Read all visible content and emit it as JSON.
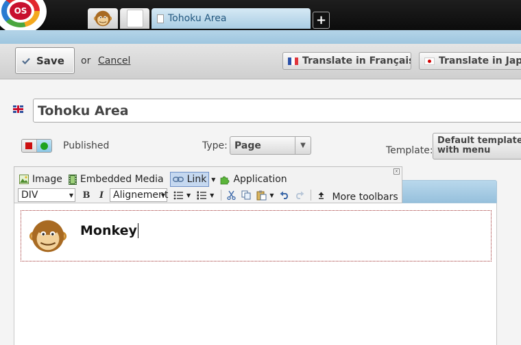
{
  "tabs": {
    "logo_text": "OS",
    "active_label": "Tohoku Area",
    "add_label": "+"
  },
  "actions": {
    "save_label": "Save",
    "or_text": "or",
    "cancel_label": "Cancel",
    "translate_fr": "Translate in Français",
    "translate_jp": "Translate in Japanese"
  },
  "form": {
    "title_value": "Tohoku Area",
    "status_label": "Published",
    "type_label": "Type:",
    "type_value": "Page",
    "template_label": "Template:",
    "template_value": "Default template with menu"
  },
  "editor": {
    "insert_image": "Image",
    "insert_media": "Embedded Media",
    "insert_link": "Link",
    "insert_app": "Application",
    "format_value": "DIV",
    "align_value": "Alignement",
    "bold": "B",
    "italic": "I",
    "more_toolbars": "More toolbars",
    "close_symbol": "x",
    "content_text": "Monkey"
  },
  "colors": {
    "tab_blue": "#a9cde3",
    "status_off": "#cc1010",
    "status_on": "#1fa31f",
    "link_text": "#23587f"
  },
  "icons": [
    "os-logo-icon",
    "monkey-icon",
    "page-icon",
    "check-icon",
    "flag-fr-icon",
    "flag-jp-icon",
    "flag-uk-icon",
    "image-icon",
    "film-icon",
    "link-icon",
    "puzzle-icon",
    "bullet-list-icon",
    "number-list-icon",
    "cut-icon",
    "copy-icon",
    "paste-icon",
    "undo-icon",
    "redo-icon",
    "arrow-up-icon"
  ]
}
